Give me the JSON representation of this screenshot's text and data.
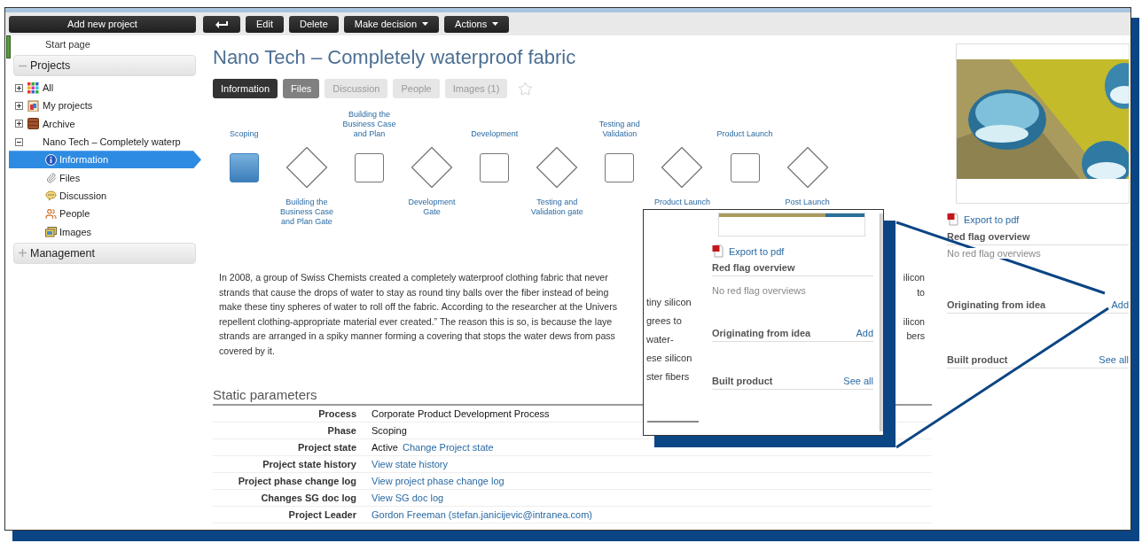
{
  "toolbar": {
    "add_button": "Add new project",
    "buttons": [
      {
        "kind": "back"
      },
      {
        "kind": "text",
        "label": "Edit"
      },
      {
        "kind": "text",
        "label": "Delete"
      },
      {
        "kind": "menu",
        "label": "Make decision"
      },
      {
        "kind": "menu",
        "label": "Actions"
      }
    ]
  },
  "sidebar": {
    "start_page": "Start page",
    "sections": [
      {
        "label": "Projects",
        "expanded": true,
        "items": [
          {
            "label": "All",
            "kind": "grid",
            "expanded": false
          },
          {
            "label": "My projects",
            "kind": "clipboard",
            "expanded": false
          },
          {
            "label": "Archive",
            "kind": "cabinet",
            "expanded": false
          },
          {
            "label": "Nano Tech – Completely waterp",
            "kind": "none",
            "expanded": true,
            "children": [
              {
                "label": "Information",
                "kind": "info",
                "selected": true
              },
              {
                "label": "Files",
                "kind": "clip",
                "selected": false
              },
              {
                "label": "Discussion",
                "kind": "chat",
                "selected": false
              },
              {
                "label": "People",
                "kind": "people",
                "selected": false
              },
              {
                "label": "Images",
                "kind": "images",
                "selected": false
              }
            ]
          }
        ]
      },
      {
        "label": "Management",
        "expanded": false
      }
    ]
  },
  "title": "Nano Tech – Completely waterproof fabric",
  "tabs": [
    {
      "label": "Information",
      "selected": true,
      "enabled": true
    },
    {
      "label": "Files",
      "selected": false,
      "enabled": true
    },
    {
      "label": "Discussion",
      "selected": false,
      "enabled": false
    },
    {
      "label": "People",
      "selected": false,
      "enabled": false
    },
    {
      "label": "Images (1)",
      "selected": false,
      "enabled": false
    }
  ],
  "starred": false,
  "process": [
    {
      "kind": "stage",
      "label": "Scoping",
      "current": true
    },
    {
      "kind": "gate",
      "label": "Building the Business Case and Plan Gate",
      "current": false
    },
    {
      "kind": "stage",
      "label": "Building the Business Case and Plan",
      "current": false
    },
    {
      "kind": "gate",
      "label": "Development Gate",
      "current": false
    },
    {
      "kind": "stage",
      "label": "Development",
      "current": false
    },
    {
      "kind": "gate",
      "label": "Testing and Validation gate",
      "current": false
    },
    {
      "kind": "stage",
      "label": "Testing and Validation",
      "current": false
    },
    {
      "kind": "gate",
      "label": "Product Launch",
      "current": false
    },
    {
      "kind": "stage",
      "label": "Product Launch",
      "current": false
    },
    {
      "kind": "gate",
      "label": "Post Launch",
      "current": false
    }
  ],
  "description": [
    {
      "left": "In 2008, a group of Swiss Chemists created a completely waterproof clothing fabric that never",
      "right": "ilicon"
    },
    {
      "left": "strands that cause the drops of water to stay as round tiny balls over the fiber instead of being",
      "right": "to"
    },
    {
      "left": "make these tiny spheres of water to roll off the fabric. According to the researcher at the Univers"
    },
    {
      "left": "repellent clothing-appropriate material ever created.” The reason this is so, is because the laye",
      "right": "ilicon"
    },
    {
      "left": "strands are arranged in a spiky manner forming a covering that stops the water dews from pass",
      "right": "bers"
    },
    {
      "left": "covered by it."
    }
  ],
  "parameters": {
    "title": "Static parameters",
    "rows": [
      {
        "label": "Process",
        "value": "Corporate Product Development Process"
      },
      {
        "label": "Phase",
        "value": "Scoping"
      },
      {
        "label": "Project state",
        "value": "Active",
        "link": "Change Project state"
      },
      {
        "label": "Project state history",
        "link": "View state history"
      },
      {
        "label": "Project phase change log",
        "link": "View project phase change log"
      },
      {
        "label": "Changes SG doc log",
        "link": "View SG doc log"
      },
      {
        "label": "Project Leader",
        "link": "Gordon Freeman (stefan.janicijevic@intranea.com)"
      }
    ]
  },
  "side_panel": {
    "export": "Export to pdf",
    "sections": [
      {
        "title": "Red flag overview",
        "empty_text": "No red flag overviews"
      },
      {
        "title": "Originating from idea",
        "action": "Add"
      },
      {
        "title": "Built product",
        "action": "See all"
      }
    ]
  },
  "zoom_inset": {
    "fragments": [
      "tiny silicon",
      "grees to",
      "water-",
      "ese silicon",
      "ster fibers"
    ],
    "export": "Export to pdf",
    "sections": [
      {
        "title": "Red flag overview",
        "empty_text": "No red flag overviews"
      },
      {
        "title": "Originating from idea",
        "action": "Add"
      },
      {
        "title": "Built product",
        "action": "See all"
      }
    ]
  }
}
